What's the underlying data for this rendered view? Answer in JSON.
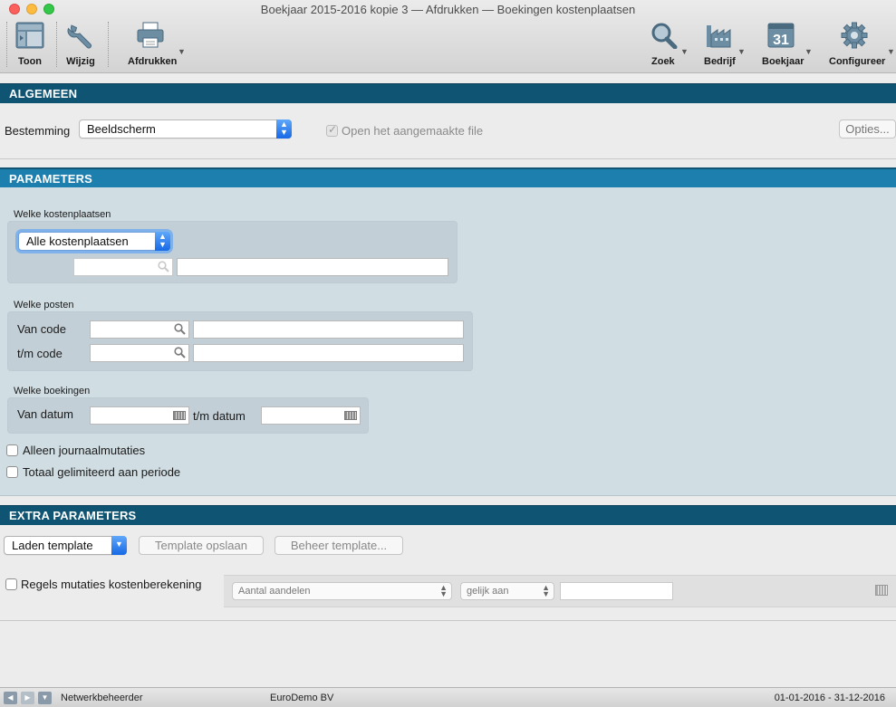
{
  "window": {
    "title": "Boekjaar 2015-2016 kopie 3 — Afdrukken — Boekingen kostenplaatsen"
  },
  "toolbar": {
    "toon": "Toon",
    "wijzig": "Wijzig",
    "afdrukken": "Afdrukken",
    "zoek": "Zoek",
    "bedrijf": "Bedrijf",
    "boekjaar": "Boekjaar",
    "boekjaar_day": "31",
    "configureer": "Configureer"
  },
  "algemeen": {
    "header": "ALGEMEEN",
    "bestemming_label": "Bestemming",
    "bestemming_value": "Beeldscherm",
    "open_file_label": "Open het aangemaakte file",
    "open_file_checked": true,
    "opties_button": "Opties..."
  },
  "parameters": {
    "header": "PARAMETERS",
    "kostenplaatsen_label": "Welke kostenplaatsen",
    "kostenplaatsen_value": "Alle kostenplaatsen",
    "posten_label": "Welke posten",
    "van_code_label": "Van code",
    "tm_code_label": "t/m code",
    "boekingen_label": "Welke boekingen",
    "van_datum_label": "Van datum",
    "tm_datum_label": "t/m datum",
    "alleen_journaal_label": "Alleen journaalmutaties",
    "totaal_label": "Totaal gelimiteerd aan periode"
  },
  "extra": {
    "header": "EXTRA PARAMETERS",
    "laden_template": "Laden template",
    "template_opslaan": "Template opslaan",
    "beheer_template": "Beheer template...",
    "regels_label": "Regels mutaties kostenberekening",
    "filter_field": "Aantal aandelen",
    "filter_operator": "gelijk aan"
  },
  "statusbar": {
    "user": "Netwerkbeheerder",
    "company": "EuroDemo BV",
    "period": "01-01-2016 - 31-12-2016"
  },
  "colors": {
    "section_dark": "#0f5473",
    "section_blue": "#1d7fae",
    "panel_bluegray": "#d0dde3",
    "accent_blue": "#1769e6"
  }
}
